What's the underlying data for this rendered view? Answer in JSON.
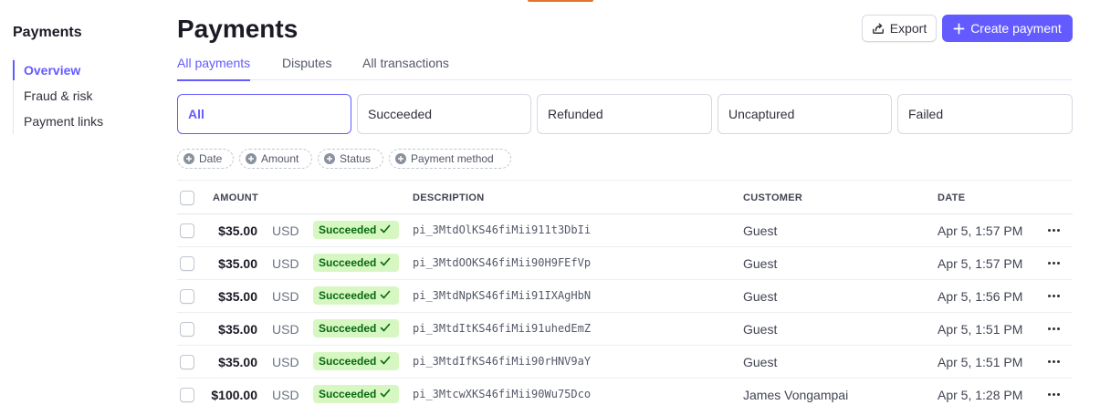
{
  "sidebar": {
    "title": "Payments",
    "items": [
      {
        "label": "Overview",
        "active": true
      },
      {
        "label": "Fraud & risk",
        "active": false
      },
      {
        "label": "Payment links",
        "active": false
      }
    ]
  },
  "header": {
    "title": "Payments",
    "export_label": "Export",
    "create_label": "Create payment"
  },
  "tabs": [
    {
      "label": "All payments",
      "active": true
    },
    {
      "label": "Disputes",
      "active": false
    },
    {
      "label": "All transactions",
      "active": false
    }
  ],
  "status_filters": [
    {
      "label": "All",
      "active": true
    },
    {
      "label": "Succeeded",
      "active": false
    },
    {
      "label": "Refunded",
      "active": false
    },
    {
      "label": "Uncaptured",
      "active": false
    },
    {
      "label": "Failed",
      "active": false
    }
  ],
  "filter_chips": [
    "Date",
    "Amount",
    "Status",
    "Payment method"
  ],
  "table": {
    "columns": {
      "amount": "AMOUNT",
      "description": "DESCRIPTION",
      "customer": "CUSTOMER",
      "date": "DATE"
    },
    "rows": [
      {
        "amount": "$35.00",
        "currency": "USD",
        "status": "Succeeded",
        "description": "pi_3MtdOlKS46fiMii911t3DbIi",
        "customer": "Guest",
        "date": "Apr 5, 1:57 PM"
      },
      {
        "amount": "$35.00",
        "currency": "USD",
        "status": "Succeeded",
        "description": "pi_3MtdOOKS46fiMii90H9FEfVp",
        "customer": "Guest",
        "date": "Apr 5, 1:57 PM"
      },
      {
        "amount": "$35.00",
        "currency": "USD",
        "status": "Succeeded",
        "description": "pi_3MtdNpKS46fiMii91IXAgHbN",
        "customer": "Guest",
        "date": "Apr 5, 1:56 PM"
      },
      {
        "amount": "$35.00",
        "currency": "USD",
        "status": "Succeeded",
        "description": "pi_3MtdItKS46fiMii91uhedEmZ",
        "customer": "Guest",
        "date": "Apr 5, 1:51 PM"
      },
      {
        "amount": "$35.00",
        "currency": "USD",
        "status": "Succeeded",
        "description": "pi_3MtdIfKS46fiMii90rHNV9aY",
        "customer": "Guest",
        "date": "Apr 5, 1:51 PM"
      },
      {
        "amount": "$100.00",
        "currency": "USD",
        "status": "Succeeded",
        "description": "pi_3MtcwXKS46fiMii90Wu75Dco",
        "customer": "James Vongampai",
        "date": "Apr 5, 1:28 PM"
      }
    ]
  },
  "colors": {
    "accent": "#635bff",
    "success_bg": "#d7f7c2",
    "success_text": "#05690d",
    "top_accent": "#e5722a"
  },
  "icons": {
    "export": "export-icon",
    "create": "plus-icon",
    "chip": "plus-circle-icon",
    "status": "check-icon",
    "row_menu": "more-horizontal-icon"
  }
}
